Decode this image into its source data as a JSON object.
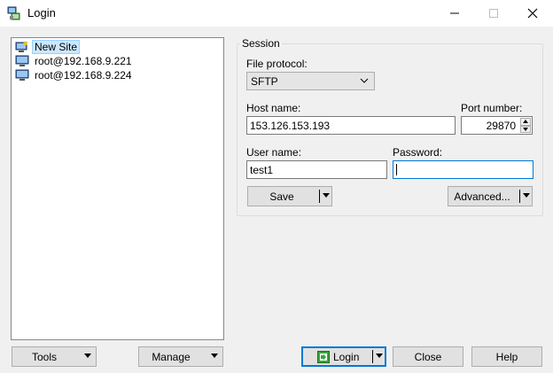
{
  "window": {
    "title": "Login"
  },
  "sites": [
    {
      "label": "New Site",
      "icon": "new-site-icon",
      "selected": true
    },
    {
      "label": "root@192.168.9.221",
      "icon": "computer-icon"
    },
    {
      "label": "root@192.168.9.224",
      "icon": "computer-icon"
    }
  ],
  "session": {
    "group_label": "Session",
    "file_protocol_label": "File protocol:",
    "file_protocol_value": "SFTP",
    "host_name_label": "Host name:",
    "host_name_value": "153.126.153.193",
    "port_number_label": "Port number:",
    "port_number_value": "29870",
    "user_name_label": "User name:",
    "user_name_value": "test1",
    "password_label": "Password:",
    "password_value": "",
    "save_label": "Save",
    "advanced_label": "Advanced..."
  },
  "footer": {
    "tools_label": "Tools",
    "manage_label": "Manage",
    "login_label": "Login",
    "close_label": "Close",
    "help_label": "Help"
  },
  "colors": {
    "selection": "#cce8ff",
    "focus_border": "#0078d7",
    "default_button_border": "#0078d7"
  }
}
